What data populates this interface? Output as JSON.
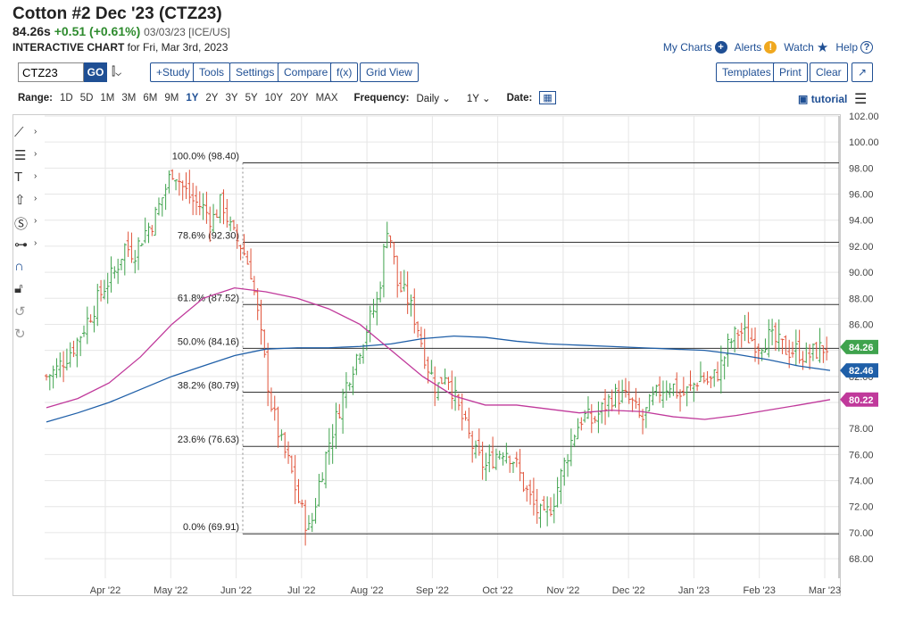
{
  "header": {
    "title": "Cotton #2 Dec '23 (CTZ23)",
    "last": "84.26s",
    "change": "+0.51 (+0.61%)",
    "meta": "03/03/23 [ICE/US]",
    "sub_bold": "INTERACTIVE CHART",
    "sub_rest": " for Fri, Mar 3rd, 2023"
  },
  "toplinks": {
    "my_charts": "My Charts",
    "alerts": "Alerts",
    "watch": "Watch",
    "help": "Help"
  },
  "toolbar": {
    "symbol": "CTZ23",
    "go": "GO",
    "study": "+Study",
    "tools": "Tools",
    "settings": "Settings",
    "compare": "Compare",
    "fx": "f(x)",
    "grid_view": "Grid View",
    "templates": "Templates",
    "print": "Print",
    "clear": "Clear"
  },
  "rangebar": {
    "range_label": "Range:",
    "ranges": [
      "1D",
      "5D",
      "1M",
      "3M",
      "6M",
      "9M",
      "1Y",
      "2Y",
      "3Y",
      "5Y",
      "10Y",
      "20Y",
      "MAX"
    ],
    "active_range": "1Y",
    "frequency_label": "Frequency:",
    "frequency": "Daily",
    "period": "1Y",
    "date_label": "Date:",
    "tutorial": "tutorial"
  },
  "chart_data": {
    "type": "ohlc-bar",
    "y_ticks": [
      "102.00",
      "100.00",
      "98.00",
      "96.00",
      "94.00",
      "92.00",
      "90.00",
      "88.00",
      "86.00",
      "84.00",
      "82.00",
      "80.00",
      "78.00",
      "76.00",
      "74.00",
      "72.00",
      "70.00",
      "68.00"
    ],
    "ylim": [
      66.5,
      102.0
    ],
    "x_ticks": [
      "Apr '22",
      "May '22",
      "Jun '22",
      "Jul '22",
      "Aug '22",
      "Sep '22",
      "Oct '22",
      "Nov '22",
      "Dec '22",
      "Jan '23",
      "Feb '23",
      "Mar '23"
    ],
    "fib_levels": [
      {
        "label": "100.0% (98.40)",
        "value": 98.4
      },
      {
        "label": "78.6% (92.30)",
        "value": 92.3
      },
      {
        "label": "61.8% (87.52)",
        "value": 87.52
      },
      {
        "label": "50.0% (84.16)",
        "value": 84.16
      },
      {
        "label": "38.2% (80.79)",
        "value": 80.79
      },
      {
        "label": "23.6% (76.63)",
        "value": 76.63
      },
      {
        "label": "0.0% (69.91)",
        "value": 69.91
      }
    ],
    "badges": [
      {
        "text": "84.26",
        "value": 84.26,
        "color": "#3fa34d"
      },
      {
        "text": "82.46",
        "value": 82.46,
        "color": "#1f5fa8"
      },
      {
        "text": "80.22",
        "value": 80.22,
        "color": "#c0399b"
      }
    ],
    "close_path": [
      82.0,
      82.5,
      83.5,
      84.5,
      86.0,
      87.5,
      89.0,
      90.0,
      92.0,
      91.5,
      93.0,
      94.0,
      96.0,
      98.0,
      96.5,
      95.5,
      95.0,
      94.0,
      95.5,
      93.0,
      92.0,
      90.0,
      85.0,
      80.0,
      77.0,
      75.0,
      72.0,
      70.0,
      74.0,
      77.0,
      79.5,
      82.0,
      84.0,
      86.0,
      88.0,
      94.0,
      89.0,
      88.0,
      86.0,
      83.0,
      81.0,
      82.5,
      80.0,
      78.0,
      76.0,
      75.0,
      76.0,
      76.5,
      75.5,
      73.5,
      72.0,
      71.0,
      72.5,
      75.0,
      77.5,
      79.0,
      78.5,
      79.5,
      80.5,
      80.5,
      80.0,
      78.5,
      80.0,
      81.0,
      81.5,
      80.5,
      81.0,
      82.0,
      81.5,
      82.5,
      84.5,
      85.5,
      85.0,
      84.5,
      85.0,
      84.5,
      84.0,
      84.0,
      83.5,
      84.0,
      84.26
    ],
    "ma_blue": [
      78.5,
      79.2,
      80.0,
      81.0,
      82.0,
      82.8,
      83.6,
      84.1,
      84.2,
      84.2,
      84.3,
      84.5,
      84.9,
      85.1,
      85.0,
      84.7,
      84.5,
      84.4,
      84.3,
      84.2,
      84.1,
      84.0,
      83.7,
      83.3,
      82.8,
      82.46
    ],
    "ma_pink": [
      79.6,
      80.3,
      81.5,
      83.5,
      86.0,
      88.0,
      88.8,
      88.5,
      88.0,
      87.2,
      86.0,
      84.0,
      82.0,
      80.5,
      79.8,
      79.8,
      79.5,
      79.2,
      79.4,
      79.3,
      78.9,
      78.7,
      79.0,
      79.4,
      79.8,
      80.22
    ],
    "colors": {
      "up": "#3fa34d",
      "down": "#e0533a",
      "blue": "#1f5fa8",
      "pink": "#c0399b",
      "grid": "#e6e6e6",
      "fib": "#333333"
    }
  }
}
